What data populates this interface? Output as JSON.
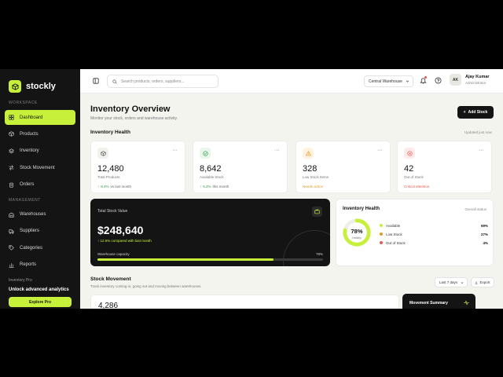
{
  "brand": {
    "name": "stockly",
    "logo_icon": "box-icon",
    "accent": "#c6f03a"
  },
  "sidebar": {
    "workspace_label": "WORKSPACE",
    "workspace_items": [
      {
        "label": "Dashboard",
        "icon": "grid-icon",
        "active": true
      },
      {
        "label": "Products",
        "icon": "package-icon"
      },
      {
        "label": "Inventory",
        "icon": "layers-icon"
      },
      {
        "label": "Stock Movement",
        "icon": "arrows-icon"
      },
      {
        "label": "Orders",
        "icon": "clipboard-icon"
      }
    ],
    "management_label": "MANAGEMENT",
    "management_items": [
      {
        "label": "Warehouses",
        "icon": "warehouse-icon"
      },
      {
        "label": "Suppliers",
        "icon": "truck-icon"
      },
      {
        "label": "Categories",
        "icon": "tag-icon"
      },
      {
        "label": "Reports",
        "icon": "chart-icon"
      }
    ],
    "promo": {
      "plan": "Inventory Pro",
      "headline": "Unlock advanced analytics",
      "button": "Explore Pro"
    }
  },
  "topbar": {
    "search_placeholder": "Search products, orders, suppliers...",
    "warehouse": "Central Warehouse",
    "user": {
      "initials": "AK",
      "name": "Ajay Kumar",
      "role": "Administrator"
    }
  },
  "page": {
    "title": "Inventory Overview",
    "subtitle": "Monitor your stock, orders and warehouse activity.",
    "add_button": "Add Stock"
  },
  "health_section": {
    "title": "Inventory Health",
    "updated": "Updated just now"
  },
  "stat_cards": [
    {
      "value": "12,480",
      "label": "Total Products",
      "delta": "8.4%",
      "note": "vs last month",
      "icon": "box-icon",
      "tint": "#f1f1ec",
      "color": "#555555"
    },
    {
      "value": "8,642",
      "label": "Available Stock",
      "delta": "5.2%",
      "note": "this month",
      "icon": "check-icon",
      "tint": "#e9f6ea",
      "color": "#2e9b46"
    },
    {
      "value": "328",
      "label": "Low Stock Items",
      "delta": "",
      "note": "Needs action",
      "icon": "warning-icon",
      "tint": "#fff3e0",
      "color": "#e39a2d"
    },
    {
      "value": "42",
      "label": "Out of Stock",
      "delta": "",
      "note": "Critical attention",
      "icon": "alert-icon",
      "tint": "#fdeaea",
      "color": "#e85a4f"
    }
  ],
  "stock_value": {
    "label": "Total Stock Value",
    "amount": "$248,640",
    "change": "12.6% compared with last month",
    "capacity_label": "Warehouse capacity",
    "capacity_pct": "78%",
    "capacity_fraction": 0.78
  },
  "health_card": {
    "title": "Inventory Health",
    "status": "Overall status",
    "donut_value": "78%",
    "donut_label": "Healthy",
    "donut_fraction": 0.78,
    "legend": [
      {
        "label": "Available",
        "pct": "69%",
        "color": "#c6f03a"
      },
      {
        "label": "Low Stock",
        "pct": "27%",
        "color": "#e39a2d"
      },
      {
        "label": "Out of Stock",
        "pct": "4%",
        "color": "#e85a4f"
      }
    ]
  },
  "movement": {
    "title": "Stock Movement",
    "subtitle": "Track inventory coming in, going out and moving between warehouses.",
    "period": "Last 7 days",
    "export": "Export",
    "value": "4,286",
    "summary_title": "Movement Summary"
  }
}
